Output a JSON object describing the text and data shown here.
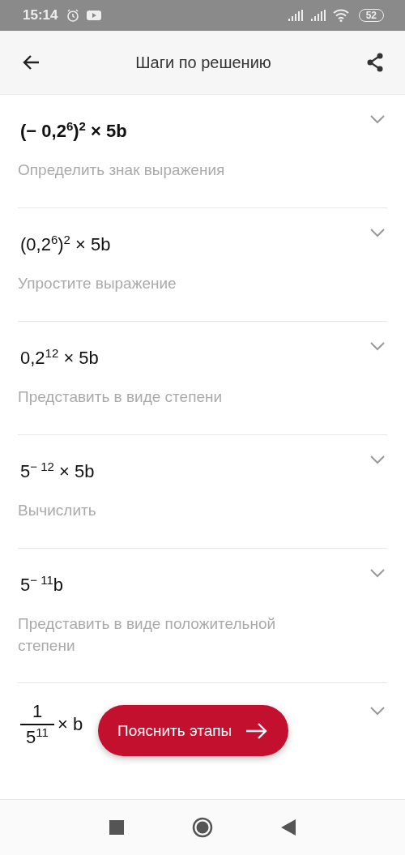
{
  "status_bar": {
    "time": "15:14",
    "battery": "52"
  },
  "header": {
    "title": "Шаги по решению"
  },
  "steps": [
    {
      "kind": "inline",
      "expression": "(− 0,2$^{6}$)$^{2}$ × 5b",
      "bold": true,
      "description": "Определить знак выражения",
      "expanded": false
    },
    {
      "kind": "inline",
      "expression": "(0,2$^{6}$)$^{2}$ × 5b",
      "bold": false,
      "description": "Упростите выражение",
      "expanded": false
    },
    {
      "kind": "inline",
      "expression": "0,2$^{12}$ × 5b",
      "bold": false,
      "description": "Представить в виде степени",
      "expanded": false
    },
    {
      "kind": "inline",
      "expression": "5$^{− 12}$ × 5b",
      "bold": false,
      "description": "Вычислить",
      "expanded": false
    },
    {
      "kind": "inline",
      "expression": "5$^{− 11}$b",
      "bold": false,
      "description": "Представить в виде положительной степени",
      "expanded": false
    },
    {
      "kind": "fraction",
      "numerator": "1",
      "denominator": "5$^{11}$",
      "rest": "× b",
      "bold": false,
      "expanded": false
    }
  ],
  "explain_button": {
    "label": "Пояснить этапы"
  }
}
